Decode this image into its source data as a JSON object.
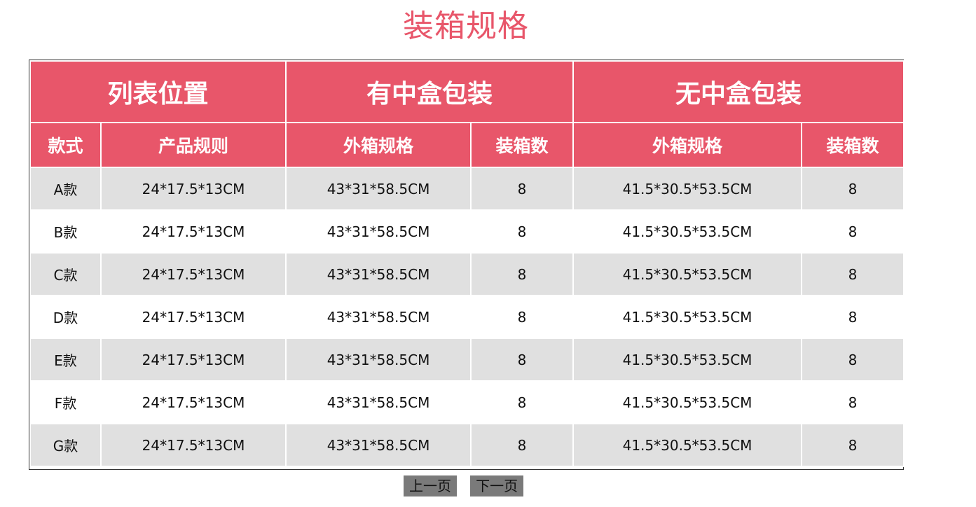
{
  "page": {
    "title": "装箱规格"
  },
  "table": {
    "group_headers": [
      "列表位置",
      "有中盒包装",
      "无中盒包装"
    ],
    "sub_headers": [
      "款式",
      "产品规则",
      "外箱规格",
      "装箱数",
      "外箱规格",
      "装箱数"
    ],
    "rows": [
      [
        "A款",
        "24*17.5*13CM",
        "43*31*58.5CM",
        "8",
        "41.5*30.5*53.5CM",
        "8"
      ],
      [
        "B款",
        "24*17.5*13CM",
        "43*31*58.5CM",
        "8",
        "41.5*30.5*53.5CM",
        "8"
      ],
      [
        "C款",
        "24*17.5*13CM",
        "43*31*58.5CM",
        "8",
        "41.5*30.5*53.5CM",
        "8"
      ],
      [
        "D款",
        "24*17.5*13CM",
        "43*31*58.5CM",
        "8",
        "41.5*30.5*53.5CM",
        "8"
      ],
      [
        "E款",
        "24*17.5*13CM",
        "43*31*58.5CM",
        "8",
        "41.5*30.5*53.5CM",
        "8"
      ],
      [
        "F款",
        "24*17.5*13CM",
        "43*31*58.5CM",
        "8",
        "41.5*30.5*53.5CM",
        "8"
      ],
      [
        "G款",
        "24*17.5*13CM",
        "43*31*58.5CM",
        "8",
        "41.5*30.5*53.5CM",
        "8"
      ]
    ]
  },
  "pager": {
    "prev_label": "上一页",
    "next_label": "下一页"
  },
  "colors": {
    "accent": "#e8566a",
    "row_alt": "#e0e0e0",
    "pager_bg": "#7a7a7a"
  }
}
